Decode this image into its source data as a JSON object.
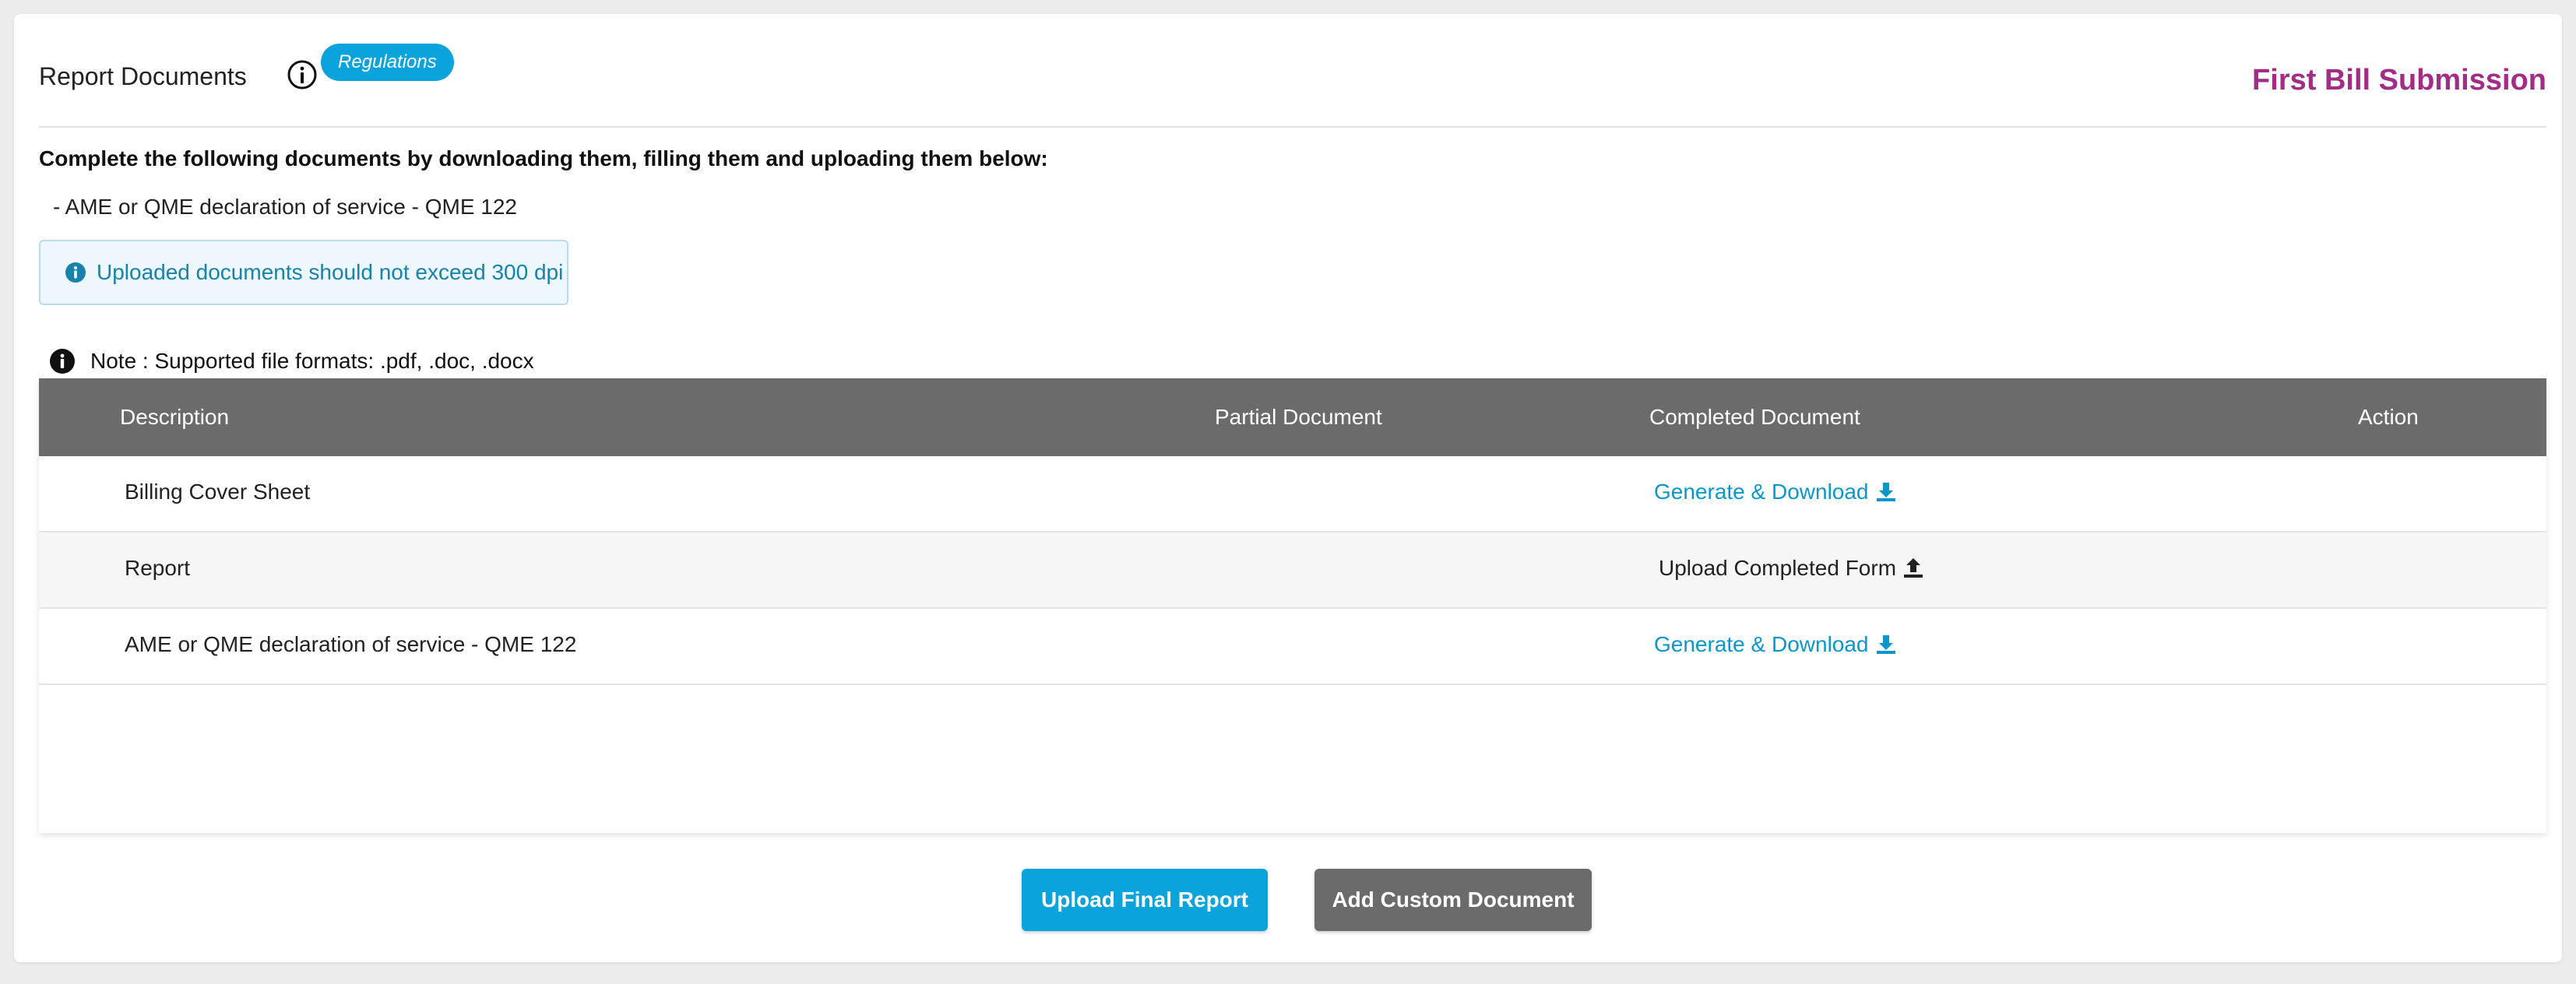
{
  "header": {
    "title": "Report Documents",
    "badge": "Regulations",
    "page_heading": "First Bill Submission"
  },
  "instructions": {
    "text": "Complete the following documents by downloading them, filling them and uploading them below:",
    "required_documents": [
      "- AME or QME declaration of service - QME 122"
    ]
  },
  "alert": {
    "text": "Uploaded documents should not exceed 300 dpi"
  },
  "note": {
    "text": "Note : Supported file formats: .pdf, .doc, .docx"
  },
  "table": {
    "columns": [
      "Description",
      "Partial Document",
      "Completed Document",
      "Action"
    ],
    "rows": [
      {
        "description": "Billing Cover Sheet",
        "partial": "",
        "completed": "Generate & Download",
        "completed_icon": "download-icon",
        "action": ""
      },
      {
        "description": "Report",
        "partial": "",
        "completed": "Upload Completed Form",
        "completed_icon": "upload-icon",
        "action": ""
      },
      {
        "description": "AME or QME declaration of service - QME 122",
        "partial": "",
        "completed": "Generate & Download",
        "completed_icon": "download-icon",
        "action": ""
      }
    ]
  },
  "buttons": {
    "upload_final": "Upload Final Report",
    "add_custom": "Add Custom Document"
  },
  "colors": {
    "accent": "#0aa3dc",
    "heading": "#a22c86",
    "table_header": "#6b6b6b",
    "row_alt": "#f6f6f6",
    "link": "#0a97cc"
  }
}
